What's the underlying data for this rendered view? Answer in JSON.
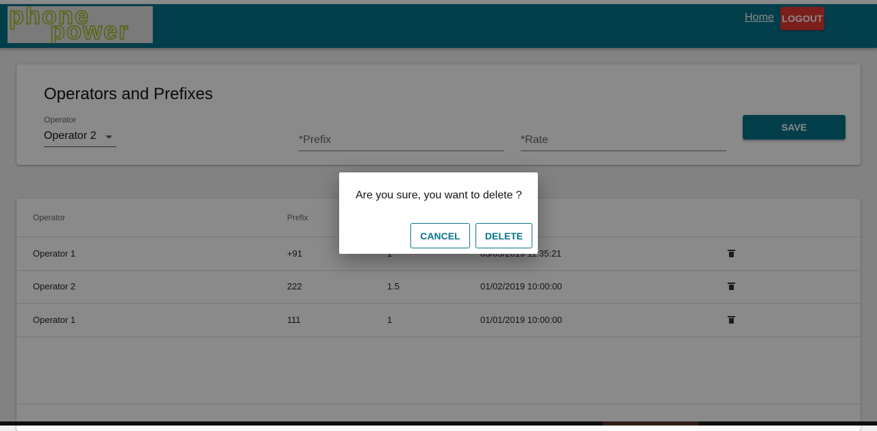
{
  "header": {
    "logo_line1": "phone",
    "logo_line2": "power",
    "home_label": "Home",
    "logout_label": "LOGOUT",
    "colors": {
      "bar": "#07738b",
      "logout": "#e53935",
      "logo": "#9cb80f"
    }
  },
  "form": {
    "title": "Operators and Prefixes",
    "operator_label": "Operator",
    "operator_value": "Operator 2",
    "prefix_placeholder": "*Prefix",
    "rate_placeholder": "*Rate",
    "save_label": "SAVE"
  },
  "table": {
    "columns": [
      "Operator",
      "Prefix",
      "",
      "",
      ""
    ],
    "rows": [
      {
        "operator": "Operator 1",
        "prefix": "+91",
        "rate": "1",
        "date": "03/03/2019 11:35:21",
        "action_icon": "trash-icon"
      },
      {
        "operator": "Operator 2",
        "prefix": "222",
        "rate": "1.5",
        "date": "01/02/2019 10:00:00",
        "action_icon": "trash-icon"
      },
      {
        "operator": "Operator 1",
        "prefix": "111",
        "rate": "1",
        "date": "01/01/2019 10:00:00",
        "action_icon": "trash-icon"
      }
    ]
  },
  "dialog": {
    "message": "Are you sure, you want to delete ?",
    "cancel_label": "CANCEL",
    "delete_label": "DELETE"
  }
}
